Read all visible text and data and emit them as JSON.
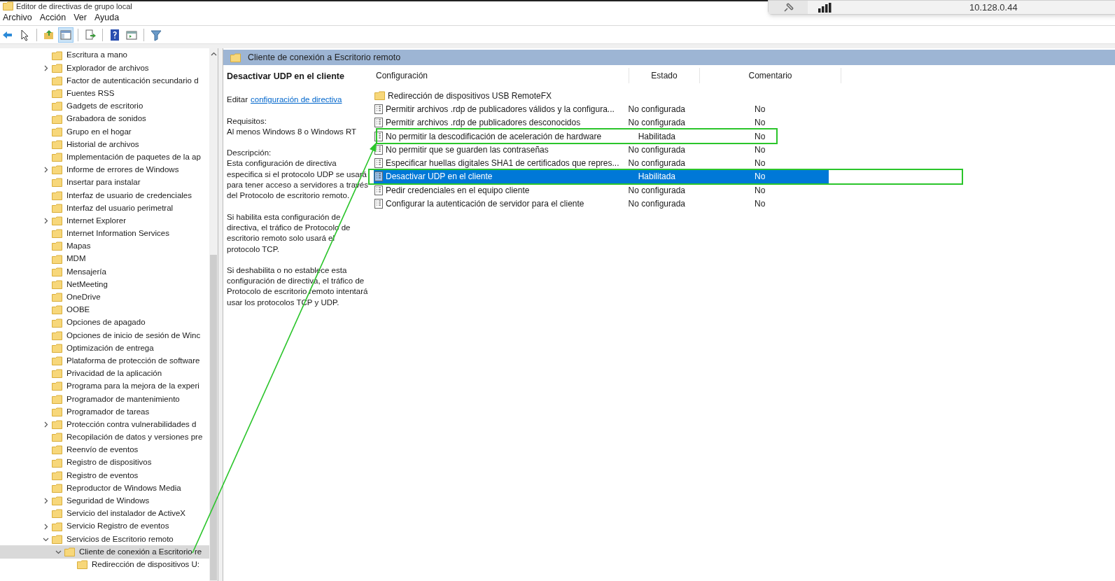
{
  "window": {
    "title": "Editor de directivas de grupo local"
  },
  "remote_bar": {
    "address": "10.128.0.44"
  },
  "menu": [
    "Archivo",
    "Acción",
    "Ver",
    "Ayuda"
  ],
  "toolbar": [
    {
      "kind": "back",
      "selected": false
    },
    {
      "kind": "pointer",
      "selected": false
    },
    {
      "kind": "up",
      "selected": false
    },
    {
      "kind": "panel",
      "selected": true
    },
    {
      "kind": "export",
      "selected": false
    },
    {
      "kind": "help",
      "selected": false
    },
    {
      "kind": "view",
      "selected": false
    },
    {
      "kind": "filter",
      "selected": false
    }
  ],
  "tree": [
    {
      "label": "Escritura a mano",
      "kind": "leaf"
    },
    {
      "label": "Explorador de archivos",
      "kind": "branch",
      "expanded": false
    },
    {
      "label": "Factor de autenticación secundario d",
      "kind": "leaf"
    },
    {
      "label": "Fuentes RSS",
      "kind": "leaf"
    },
    {
      "label": "Gadgets de escritorio",
      "kind": "leaf"
    },
    {
      "label": "Grabadora de sonidos",
      "kind": "leaf"
    },
    {
      "label": "Grupo en el hogar",
      "kind": "leaf"
    },
    {
      "label": "Historial de archivos",
      "kind": "leaf"
    },
    {
      "label": "Implementación de paquetes de la ap",
      "kind": "leaf"
    },
    {
      "label": "Informe de errores de Windows",
      "kind": "branch",
      "expanded": false
    },
    {
      "label": "Insertar para instalar",
      "kind": "leaf"
    },
    {
      "label": "Interfaz de usuario de credenciales",
      "kind": "leaf"
    },
    {
      "label": "Interfaz del usuario perimetral",
      "kind": "leaf"
    },
    {
      "label": "Internet Explorer",
      "kind": "branch",
      "expanded": false
    },
    {
      "label": "Internet Information Services",
      "kind": "leaf"
    },
    {
      "label": "Mapas",
      "kind": "leaf"
    },
    {
      "label": "MDM",
      "kind": "leaf"
    },
    {
      "label": "Mensajería",
      "kind": "leaf"
    },
    {
      "label": "NetMeeting",
      "kind": "leaf"
    },
    {
      "label": "OneDrive",
      "kind": "leaf"
    },
    {
      "label": "OOBE",
      "kind": "leaf"
    },
    {
      "label": "Opciones de apagado",
      "kind": "leaf"
    },
    {
      "label": "Opciones de inicio de sesión de Winc",
      "kind": "leaf"
    },
    {
      "label": "Optimización de entrega",
      "kind": "leaf"
    },
    {
      "label": "Plataforma de protección de software",
      "kind": "leaf"
    },
    {
      "label": "Privacidad de la aplicación",
      "kind": "leaf"
    },
    {
      "label": "Programa para la mejora de la experi",
      "kind": "leaf"
    },
    {
      "label": "Programador de mantenimiento",
      "kind": "leaf"
    },
    {
      "label": "Programador de tareas",
      "kind": "leaf"
    },
    {
      "label": "Protección contra vulnerabilidades d",
      "kind": "branch",
      "expanded": false
    },
    {
      "label": "Recopilación de datos y versiones pre",
      "kind": "leaf"
    },
    {
      "label": "Reenvío de eventos",
      "kind": "leaf"
    },
    {
      "label": "Registro de dispositivos",
      "kind": "leaf"
    },
    {
      "label": "Registro de eventos",
      "kind": "leaf"
    },
    {
      "label": "Reproductor de Windows Media",
      "kind": "leaf"
    },
    {
      "label": "Seguridad de Windows",
      "kind": "branch",
      "expanded": false
    },
    {
      "label": "Servicio del instalador de ActiveX",
      "kind": "leaf"
    },
    {
      "label": "Servicio Registro de eventos",
      "kind": "branch",
      "expanded": false
    },
    {
      "label": "Servicios de Escritorio remoto",
      "kind": "branch",
      "expanded": true,
      "children": [
        {
          "label": "Cliente de conexión a Escritorio re",
          "kind": "branch",
          "expanded": true,
          "selected": true,
          "children": [
            {
              "label": "Redirección de dispositivos U:",
              "kind": "leaf"
            }
          ]
        }
      ]
    }
  ],
  "pane": {
    "header": "Cliente de conexión a Escritorio remoto",
    "detail": {
      "title": "Desactivar UDP en el cliente",
      "edit_prefix": "Editar",
      "edit_link": "configuración de directiva",
      "requirements_label": "Requisitos:",
      "requirements": "Al menos Windows 8 o Windows RT",
      "description_label": "Descripción:",
      "paragraphs": [
        "Esta configuración de directiva especifica si el protocolo UDP se usará para tener acceso a servidores a través del Protocolo de escritorio remoto.",
        "Si habilita esta configuración de directiva, el tráfico de Protocolo de escritorio remoto solo usará el protocolo TCP.",
        "Si deshabilita o no establece esta configuración de directiva, el tráfico de Protocolo de escritorio remoto intentará usar los protocolos TCP y UDP."
      ]
    },
    "table": {
      "columns": [
        "Configuración",
        "Estado",
        "Comentario"
      ],
      "rows": [
        {
          "kind": "folder",
          "name": "Redirección de dispositivos USB RemoteFX",
          "selected": false,
          "highlighted": false
        },
        {
          "kind": "setting",
          "name": "Permitir archivos .rdp de publicadores válidos y la configura...",
          "state": "No configurada",
          "comment": "No",
          "selected": false,
          "highlighted": false
        },
        {
          "kind": "setting",
          "name": "Permitir archivos .rdp de publicadores desconocidos",
          "state": "No configurada",
          "comment": "No",
          "selected": false,
          "highlighted": false
        },
        {
          "kind": "setting",
          "name": "No permitir la descodificación de aceleración de hardware",
          "state": "Habilitada",
          "comment": "No",
          "selected": false,
          "highlighted": true
        },
        {
          "kind": "setting",
          "name": "No permitir que se guarden las contraseñas",
          "state": "No configurada",
          "comment": "No",
          "selected": false,
          "highlighted": false
        },
        {
          "kind": "setting",
          "name": "Especificar huellas digitales SHA1 de certificados que repres...",
          "state": "No configurada",
          "comment": "No",
          "selected": false,
          "highlighted": false
        },
        {
          "kind": "setting",
          "name": "Desactivar UDP en el cliente",
          "state": "Habilitada",
          "comment": "No",
          "selected": true,
          "highlighted": true
        },
        {
          "kind": "setting",
          "name": "Pedir credenciales en el equipo cliente",
          "state": "No configurada",
          "comment": "No",
          "selected": false,
          "highlighted": false
        },
        {
          "kind": "setting",
          "name": "Configurar la autenticación de servidor para el cliente",
          "state": "No configurada",
          "comment": "No",
          "selected": false,
          "highlighted": false
        }
      ]
    }
  }
}
